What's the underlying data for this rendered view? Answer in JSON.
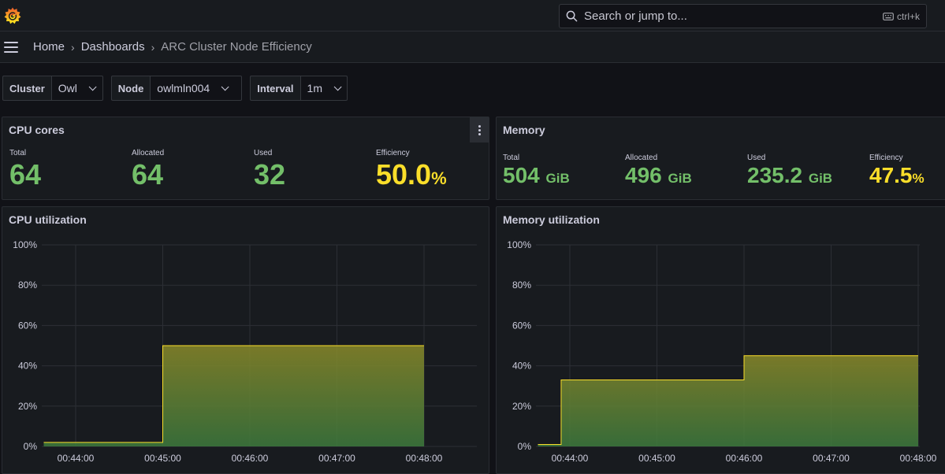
{
  "search": {
    "placeholder": "Search or jump to...",
    "shortcut": "ctrl+k"
  },
  "breadcrumb": [
    "Home",
    "Dashboards",
    "ARC Cluster Node Efficiency"
  ],
  "variables": [
    {
      "label": "Cluster",
      "value": "Owl"
    },
    {
      "label": "Node",
      "value": "owlmln004"
    },
    {
      "label": "Interval",
      "value": "1m"
    }
  ],
  "cpu_cores": {
    "title": "CPU cores",
    "total_label": "Total",
    "total": "64",
    "allocated_label": "Allocated",
    "allocated": "64",
    "used_label": "Used",
    "used": "32",
    "efficiency_label": "Efficiency",
    "efficiency": "50.0",
    "efficiency_unit": "%"
  },
  "memory": {
    "title": "Memory",
    "total_label": "Total",
    "total": "504",
    "total_unit": "GiB",
    "allocated_label": "Allocated",
    "allocated": "496",
    "allocated_unit": "GiB",
    "used_label": "Used",
    "used": "235.2",
    "used_unit": "GiB",
    "efficiency_label": "Efficiency",
    "efficiency": "47.5",
    "efficiency_unit": "%"
  },
  "colors": {
    "green": "#73bf69",
    "yellow": "#fade2a",
    "line": "#fade2a"
  },
  "chart_data": [
    {
      "type": "area",
      "title": "CPU utilization",
      "y_ticks": [
        "100%",
        "80%",
        "60%",
        "40%",
        "20%",
        "0%"
      ],
      "x_ticks": [
        "00:44:00",
        "00:45:00",
        "00:46:00",
        "00:47:00",
        "00:48:00"
      ],
      "ylim": [
        0,
        100
      ],
      "step": true,
      "x": [
        "00:43:38",
        "00:45:00",
        "00:48:00"
      ],
      "values": [
        2,
        50,
        50
      ]
    },
    {
      "type": "area",
      "title": "Memory utilization",
      "y_ticks": [
        "100%",
        "80%",
        "60%",
        "40%",
        "20%",
        "0%"
      ],
      "x_ticks": [
        "00:44:00",
        "00:45:00",
        "00:46:00",
        "00:47:00",
        "00:48:00"
      ],
      "ylim": [
        0,
        100
      ],
      "step": true,
      "x": [
        "00:43:38",
        "00:43:54",
        "00:46:00",
        "00:48:00"
      ],
      "values": [
        1,
        33,
        45,
        45
      ]
    }
  ]
}
